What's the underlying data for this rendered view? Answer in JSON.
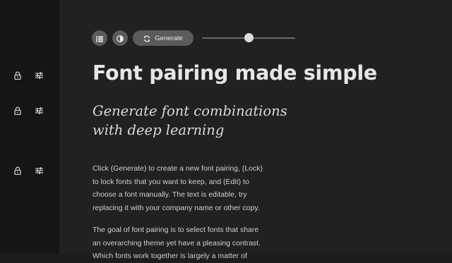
{
  "colors": {
    "rail_bg": "#151515",
    "main_bg": "#212121",
    "button_bg": "#5b5b5b",
    "text_primary": "#e6e6e6",
    "text_body": "#d0d0d0"
  },
  "sidebar": {
    "rows": [
      {
        "lock_icon": "lock-icon",
        "edit_icon": "sliders-icon"
      },
      {
        "lock_icon": "lock-icon",
        "edit_icon": "sliders-icon"
      },
      {
        "lock_icon": "lock-icon",
        "edit_icon": "sliders-icon"
      }
    ]
  },
  "toolbar": {
    "list_icon": "list-icon",
    "contrast_icon": "contrast-icon",
    "generate_icon": "refresh-icon",
    "generate_label": "Generate",
    "slider_value": 0.5
  },
  "content": {
    "heading": "Font pairing made simple",
    "subheading_lines": [
      "Generate font combinations",
      "with deep learning"
    ],
    "paragraph1_lines": [
      "Click (Generate) to create a new font pairing, (Lock)",
      "to lock fonts that you want to keep, and (Edit) to",
      "choose a font manually. The text is editable, try",
      "replacing it with your company name or other copy."
    ],
    "paragraph2_lines": [
      "The goal of font pairing is to select fonts that share",
      "an overarching theme yet have a pleasing contrast.",
      "Which fonts work together is largely a matter of"
    ]
  }
}
